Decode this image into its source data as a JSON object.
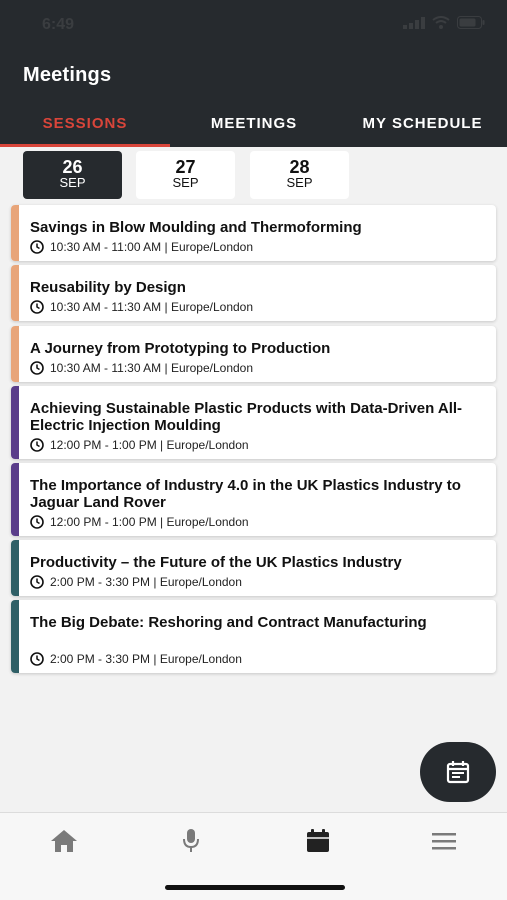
{
  "status_bar": {
    "time": "6:49"
  },
  "header": {
    "title": "Meetings"
  },
  "tabs": [
    {
      "label": "SESSIONS",
      "active": true
    },
    {
      "label": "MEETINGS",
      "active": false
    },
    {
      "label": "MY SCHEDULE",
      "active": false
    }
  ],
  "dates": [
    {
      "day": "26",
      "month": "SEP",
      "active": true
    },
    {
      "day": "27",
      "month": "SEP",
      "active": false
    },
    {
      "day": "28",
      "month": "SEP",
      "active": false
    }
  ],
  "colors": {
    "header_bg": "#262a2e",
    "accent": "#d9453a",
    "track_orange": "#e8a57a",
    "track_purple": "#5a3d8a",
    "track_teal": "#2f5f66"
  },
  "sessions": [
    {
      "title": "Savings in Blow Moulding and Thermoforming",
      "time": "10:30 AM - 11:00 AM | Europe/London",
      "color": "#e8a57a"
    },
    {
      "title": "Reusability by Design",
      "time": "10:30 AM - 11:30 AM | Europe/London",
      "color": "#e8a57a"
    },
    {
      "title": "A Journey from Prototyping to Production",
      "time": "10:30 AM - 11:30 AM | Europe/London",
      "color": "#e8a57a"
    },
    {
      "title": "Achieving Sustainable Plastic Products with Data-Driven All-Electric Injection Moulding",
      "time": "12:00 PM - 1:00 PM | Europe/London",
      "color": "#5a3d8a"
    },
    {
      "title": "The Importance of Industry 4.0 in the UK Plastics Industry to Jaguar Land Rover",
      "time": "12:00 PM - 1:00 PM | Europe/London",
      "color": "#5a3d8a"
    },
    {
      "title": "Productivity – the Future of the UK Plastics Industry",
      "time": "2:00 PM - 3:30 PM | Europe/London",
      "color": "#2f5f66"
    },
    {
      "title": "The Big Debate: Reshoring and Contract Manufacturing",
      "time": "2:00 PM - 3:30 PM | Europe/London",
      "color": "#2f5f66"
    }
  ],
  "fab": {
    "icon": "calendar-list-icon"
  },
  "bottom_nav": [
    {
      "icon": "home-icon"
    },
    {
      "icon": "microphone-icon"
    },
    {
      "icon": "calendar-icon",
      "active": true
    },
    {
      "icon": "menu-icon"
    }
  ]
}
